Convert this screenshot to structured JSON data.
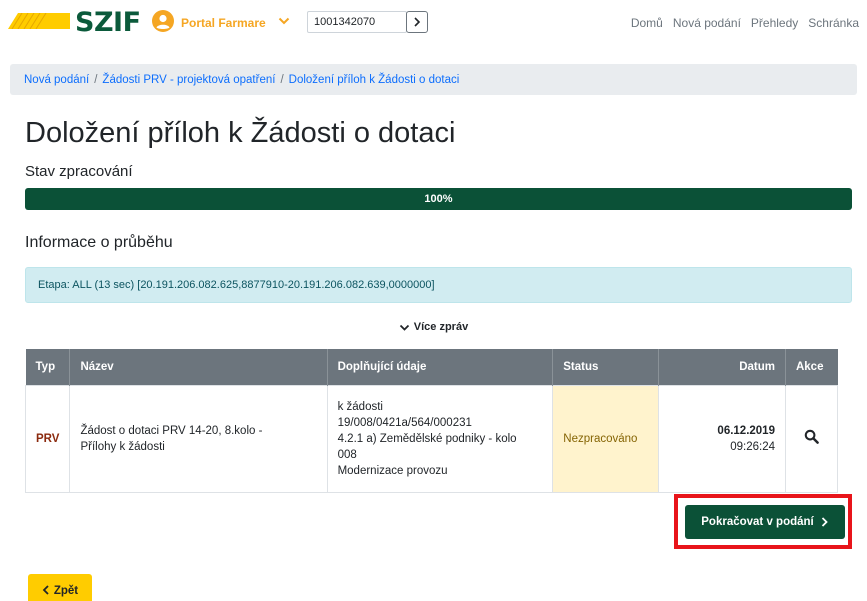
{
  "header": {
    "logo_text": "SZIF",
    "portal_label": "Portal Farmare",
    "id_value": "1001342070",
    "nav": [
      "Domů",
      "Nová podání",
      "Přehledy",
      "Schránka"
    ]
  },
  "breadcrumb": [
    "Nová podání",
    "Žádosti PRV - projektová opatření",
    "Doložení příloh k Žádosti o dotaci"
  ],
  "title": "Doložení příloh k Žádosti o dotaci",
  "status_heading": "Stav zpracování",
  "progress": {
    "value": 100,
    "label": "100%"
  },
  "info_heading": "Informace o průběhu",
  "alert_text": "Etapa: ALL (13 sec) [20.191.206.082.625,8877910-20.191.206.082.639,0000000]",
  "more_label": "Více zpráv",
  "table": {
    "headers": [
      "Typ",
      "Název",
      "Doplňující údaje",
      "Status",
      "Datum",
      "Akce"
    ],
    "row": {
      "typ": "PRV",
      "nazev_1": "Žádost o dotaci PRV 14-20, 8.kolo -",
      "nazev_2": "Přílohy k žádosti",
      "doplnujici_1": "k žádosti",
      "doplnujici_2": "19/008/0421a/564/000231",
      "doplnujici_3": "4.2.1 a) Zemědělské podniky - kolo",
      "doplnujici_4": "008",
      "doplnujici_5": "Modernizace provozu",
      "status": "Nezpracováno",
      "date": "06.12.2019",
      "time": "09:26:24"
    }
  },
  "continue_label": "Pokračovat v podání",
  "back_label": "Zpět",
  "colors": {
    "brand_green": "#0b5137",
    "logo_yellow": "#ffcc00",
    "highlight_red": "#e8141a",
    "status_bg": "#fff3cd"
  }
}
